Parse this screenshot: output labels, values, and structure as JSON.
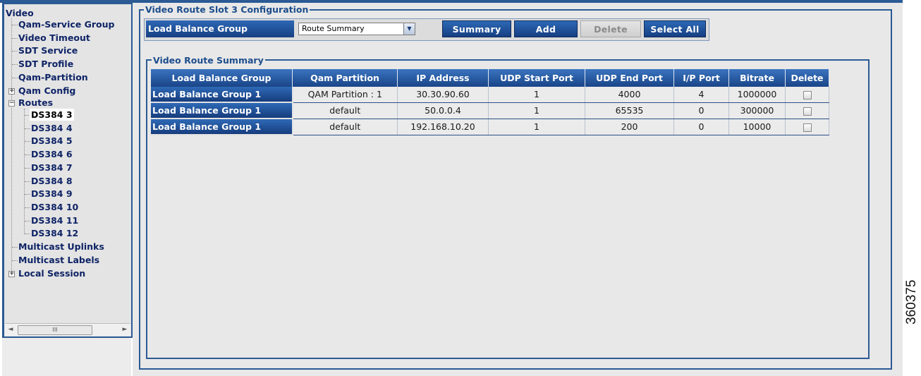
{
  "tree": {
    "root": "Video",
    "items": [
      {
        "label": "Qam-Service Group"
      },
      {
        "label": "Video Timeout"
      },
      {
        "label": "SDT Service"
      },
      {
        "label": "SDT Profile"
      },
      {
        "label": "Qam-Partition"
      },
      {
        "label": "Qam Config",
        "toggle": "+"
      },
      {
        "label": "Routes",
        "toggle": "−"
      },
      {
        "label": "DS384 3",
        "selected": true
      },
      {
        "label": "DS384 4"
      },
      {
        "label": "DS384 5"
      },
      {
        "label": "DS384 6"
      },
      {
        "label": "DS384 7"
      },
      {
        "label": "DS384 8"
      },
      {
        "label": "DS384 9"
      },
      {
        "label": "DS384 10"
      },
      {
        "label": "DS384 11"
      },
      {
        "label": "DS384 12"
      },
      {
        "label": "Multicast Uplinks"
      },
      {
        "label": "Multicast Labels"
      },
      {
        "label": "Local Session",
        "toggle": "+"
      }
    ],
    "scroll_left": "◄",
    "scroll_right": "►",
    "scroll_thumb": "III"
  },
  "config": {
    "title": "Video Route Slot 3 Configuration",
    "toolbar": {
      "label": "Load Balance Group",
      "select_value": "Route Summary",
      "select_arrow": "▼",
      "summary_button": "Summary",
      "add_button": "Add",
      "delete_button": "Delete",
      "select_all_button": "Select All"
    },
    "summary": {
      "title": "Video Route Summary",
      "columns": [
        "Load Balance Group",
        "Qam Partition",
        "IP Address",
        "UDP Start Port",
        "UDP End Port",
        "I/P Port",
        "Bitrate",
        "Delete"
      ],
      "rows": [
        [
          "Load Balance Group 1",
          "QAM Partition : 1",
          "30.30.90.60",
          "1",
          "4000",
          "4",
          "1000000"
        ],
        [
          "Load Balance Group 1",
          "default",
          "50.0.0.4",
          "1",
          "65535",
          "0",
          "300000"
        ],
        [
          "Load Balance Group 1",
          "default",
          "192.168.10.20",
          "1",
          "200",
          "0",
          "10000"
        ]
      ]
    }
  },
  "figure_id": "360375"
}
